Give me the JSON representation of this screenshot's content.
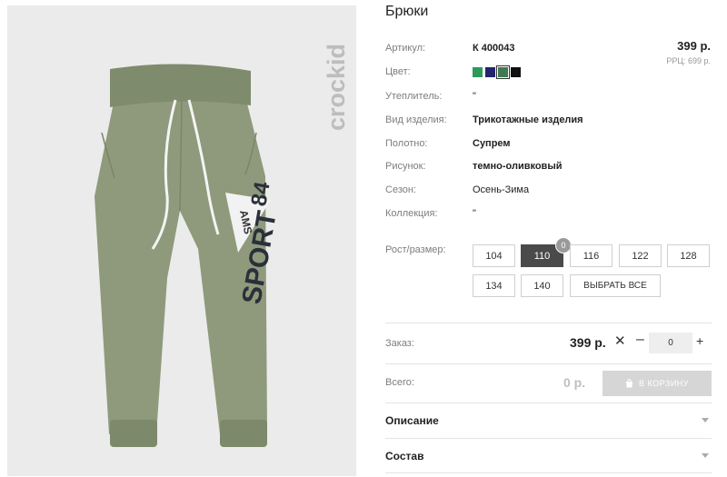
{
  "product": {
    "title": "Брюки",
    "brand": "crockid",
    "price": "399 р.",
    "rrp": "РРЦ: 699 р."
  },
  "image": {
    "print_text": "SPORT",
    "print_number": "84",
    "print_pennant": "AMS"
  },
  "attributes": [
    {
      "label": "Артикул:",
      "value": "К 400043",
      "bold": true
    },
    {
      "label": "Цвет:",
      "value": "",
      "bold": false
    },
    {
      "label": "Утеплитель:",
      "value": "\"",
      "bold": false
    },
    {
      "label": "Вид изделия:",
      "value": "Трикотажные изделия",
      "bold": true
    },
    {
      "label": "Полотно:",
      "value": "Супрем",
      "bold": true
    },
    {
      "label": "Рисунок:",
      "value": "темно-оливковый",
      "bold": true
    },
    {
      "label": "Сезон:",
      "value": "Осень-Зима",
      "bold": false
    },
    {
      "label": "Коллекция:",
      "value": "\"",
      "bold": false
    }
  ],
  "colors": [
    {
      "hex": "#2e9a5c",
      "selected": false
    },
    {
      "hex": "#22246e",
      "selected": false
    },
    {
      "hex": "#3f7a52",
      "selected": true
    },
    {
      "hex": "#111111",
      "selected": false
    }
  ],
  "sizes": {
    "label": "Рост/размер:",
    "options": [
      "104",
      "110",
      "116",
      "122",
      "128",
      "134",
      "140"
    ],
    "selected": "110",
    "selected_count": "0",
    "select_all": "ВЫБРАТЬ ВСЕ"
  },
  "order": {
    "label": "Заказ:",
    "price": "399 р.",
    "times": "✕",
    "minus": "–",
    "quantity": "0",
    "plus": "+"
  },
  "total": {
    "label": "Всего:",
    "value": "0 р.",
    "cart_button": "В КОРЗИНУ"
  },
  "accordion": [
    {
      "label": "Описание"
    },
    {
      "label": "Состав"
    }
  ]
}
